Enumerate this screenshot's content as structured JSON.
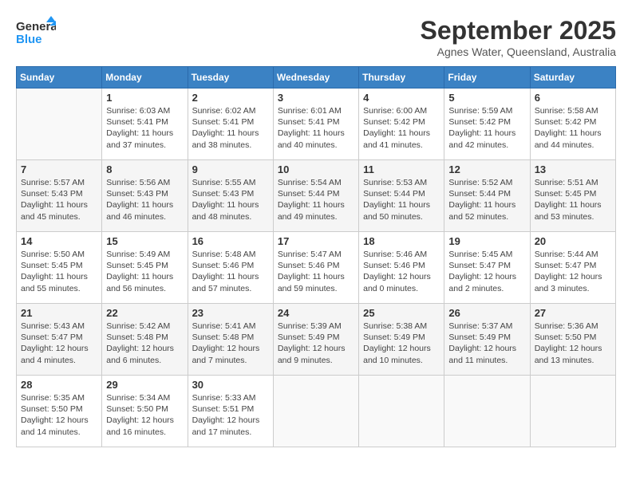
{
  "logo": {
    "line1": "General",
    "line2": "Blue"
  },
  "title": "September 2025",
  "subtitle": "Agnes Water, Queensland, Australia",
  "days_header": [
    "Sunday",
    "Monday",
    "Tuesday",
    "Wednesday",
    "Thursday",
    "Friday",
    "Saturday"
  ],
  "weeks": [
    [
      {
        "day": "",
        "info": ""
      },
      {
        "day": "1",
        "info": "Sunrise: 6:03 AM\nSunset: 5:41 PM\nDaylight: 11 hours\nand 37 minutes."
      },
      {
        "day": "2",
        "info": "Sunrise: 6:02 AM\nSunset: 5:41 PM\nDaylight: 11 hours\nand 38 minutes."
      },
      {
        "day": "3",
        "info": "Sunrise: 6:01 AM\nSunset: 5:41 PM\nDaylight: 11 hours\nand 40 minutes."
      },
      {
        "day": "4",
        "info": "Sunrise: 6:00 AM\nSunset: 5:42 PM\nDaylight: 11 hours\nand 41 minutes."
      },
      {
        "day": "5",
        "info": "Sunrise: 5:59 AM\nSunset: 5:42 PM\nDaylight: 11 hours\nand 42 minutes."
      },
      {
        "day": "6",
        "info": "Sunrise: 5:58 AM\nSunset: 5:42 PM\nDaylight: 11 hours\nand 44 minutes."
      }
    ],
    [
      {
        "day": "7",
        "info": "Sunrise: 5:57 AM\nSunset: 5:43 PM\nDaylight: 11 hours\nand 45 minutes."
      },
      {
        "day": "8",
        "info": "Sunrise: 5:56 AM\nSunset: 5:43 PM\nDaylight: 11 hours\nand 46 minutes."
      },
      {
        "day": "9",
        "info": "Sunrise: 5:55 AM\nSunset: 5:43 PM\nDaylight: 11 hours\nand 48 minutes."
      },
      {
        "day": "10",
        "info": "Sunrise: 5:54 AM\nSunset: 5:44 PM\nDaylight: 11 hours\nand 49 minutes."
      },
      {
        "day": "11",
        "info": "Sunrise: 5:53 AM\nSunset: 5:44 PM\nDaylight: 11 hours\nand 50 minutes."
      },
      {
        "day": "12",
        "info": "Sunrise: 5:52 AM\nSunset: 5:44 PM\nDaylight: 11 hours\nand 52 minutes."
      },
      {
        "day": "13",
        "info": "Sunrise: 5:51 AM\nSunset: 5:45 PM\nDaylight: 11 hours\nand 53 minutes."
      }
    ],
    [
      {
        "day": "14",
        "info": "Sunrise: 5:50 AM\nSunset: 5:45 PM\nDaylight: 11 hours\nand 55 minutes."
      },
      {
        "day": "15",
        "info": "Sunrise: 5:49 AM\nSunset: 5:45 PM\nDaylight: 11 hours\nand 56 minutes."
      },
      {
        "day": "16",
        "info": "Sunrise: 5:48 AM\nSunset: 5:46 PM\nDaylight: 11 hours\nand 57 minutes."
      },
      {
        "day": "17",
        "info": "Sunrise: 5:47 AM\nSunset: 5:46 PM\nDaylight: 11 hours\nand 59 minutes."
      },
      {
        "day": "18",
        "info": "Sunrise: 5:46 AM\nSunset: 5:46 PM\nDaylight: 12 hours\nand 0 minutes."
      },
      {
        "day": "19",
        "info": "Sunrise: 5:45 AM\nSunset: 5:47 PM\nDaylight: 12 hours\nand 2 minutes."
      },
      {
        "day": "20",
        "info": "Sunrise: 5:44 AM\nSunset: 5:47 PM\nDaylight: 12 hours\nand 3 minutes."
      }
    ],
    [
      {
        "day": "21",
        "info": "Sunrise: 5:43 AM\nSunset: 5:47 PM\nDaylight: 12 hours\nand 4 minutes."
      },
      {
        "day": "22",
        "info": "Sunrise: 5:42 AM\nSunset: 5:48 PM\nDaylight: 12 hours\nand 6 minutes."
      },
      {
        "day": "23",
        "info": "Sunrise: 5:41 AM\nSunset: 5:48 PM\nDaylight: 12 hours\nand 7 minutes."
      },
      {
        "day": "24",
        "info": "Sunrise: 5:39 AM\nSunset: 5:49 PM\nDaylight: 12 hours\nand 9 minutes."
      },
      {
        "day": "25",
        "info": "Sunrise: 5:38 AM\nSunset: 5:49 PM\nDaylight: 12 hours\nand 10 minutes."
      },
      {
        "day": "26",
        "info": "Sunrise: 5:37 AM\nSunset: 5:49 PM\nDaylight: 12 hours\nand 11 minutes."
      },
      {
        "day": "27",
        "info": "Sunrise: 5:36 AM\nSunset: 5:50 PM\nDaylight: 12 hours\nand 13 minutes."
      }
    ],
    [
      {
        "day": "28",
        "info": "Sunrise: 5:35 AM\nSunset: 5:50 PM\nDaylight: 12 hours\nand 14 minutes."
      },
      {
        "day": "29",
        "info": "Sunrise: 5:34 AM\nSunset: 5:50 PM\nDaylight: 12 hours\nand 16 minutes."
      },
      {
        "day": "30",
        "info": "Sunrise: 5:33 AM\nSunset: 5:51 PM\nDaylight: 12 hours\nand 17 minutes."
      },
      {
        "day": "",
        "info": ""
      },
      {
        "day": "",
        "info": ""
      },
      {
        "day": "",
        "info": ""
      },
      {
        "day": "",
        "info": ""
      }
    ]
  ]
}
